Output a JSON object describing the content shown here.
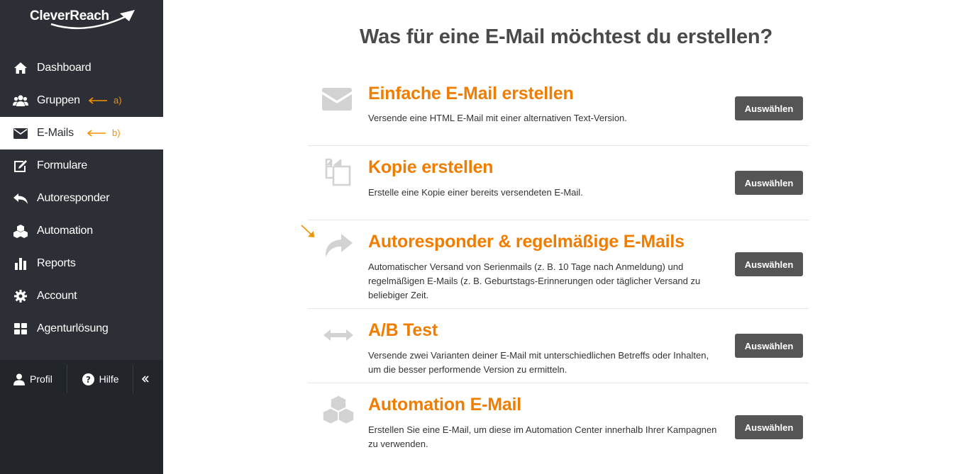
{
  "app": {
    "logo_text": "CleverReach"
  },
  "sidebar": {
    "items": [
      {
        "label": "Dashboard",
        "icon": "home-icon",
        "active": false
      },
      {
        "label": "Gruppen",
        "icon": "users-icon",
        "active": false,
        "annotation": "a)"
      },
      {
        "label": "E-Mails",
        "icon": "envelope-icon",
        "active": true,
        "annotation": "b)"
      },
      {
        "label": "Formulare",
        "icon": "edit-icon",
        "active": false
      },
      {
        "label": "Autoresponder",
        "icon": "reply-all-icon",
        "active": false
      },
      {
        "label": "Automation",
        "icon": "cubes-icon",
        "active": false
      },
      {
        "label": "Reports",
        "icon": "bar-chart-icon",
        "active": false
      },
      {
        "label": "Account",
        "icon": "gear-icon",
        "active": false
      },
      {
        "label": "Agenturlösung",
        "icon": "grid-icon",
        "active": false
      }
    ],
    "bottom": {
      "profile_label": "Profil",
      "help_label": "Hilfe",
      "collapse_icon": "double-chevron-left-icon"
    }
  },
  "main": {
    "title": "Was für eine E-Mail möchtest du erstellen?",
    "button_label": "Auswählen",
    "options": [
      {
        "title": "Einfache E-Mail erstellen",
        "description": "Versende eine HTML E-Mail mit einer alternativen Text-Version.",
        "icon": "envelope-icon"
      },
      {
        "title": "Kopie erstellen",
        "description": "Erstelle eine Kopie einer bereits versendeten E-Mail.",
        "icon": "copy-icon"
      },
      {
        "title": "Autoresponder & regelmäßige E-Mails",
        "description": "Automatischer Versand von Serienmails (z. B. 10 Tage nach Anmeldung) und regelmäßigen E-Mails (z. B. Geburtstags-Erinnerungen oder täglicher Versand zu beliebiger Zeit.",
        "icon": "share-arrow-icon"
      },
      {
        "title": "A/B Test",
        "description": "Versende zwei Varianten deiner E-Mail mit unterschiedlichen Betreffs oder Inhalten, um die besser performende Version zu ermitteln.",
        "icon": "horizontal-arrows-icon"
      },
      {
        "title": "Automation E-Mail",
        "description": "Erstellen Sie eine E-Mail, um diese im Automation Center innerhalb Ihrer Kampagnen zu verwenden.",
        "icon": "cubes-icon"
      }
    ]
  },
  "colors": {
    "accent": "#f07d00",
    "annotation": "#f39200",
    "sidebar_bg": "#2c2f35",
    "button_bg": "#555555"
  }
}
